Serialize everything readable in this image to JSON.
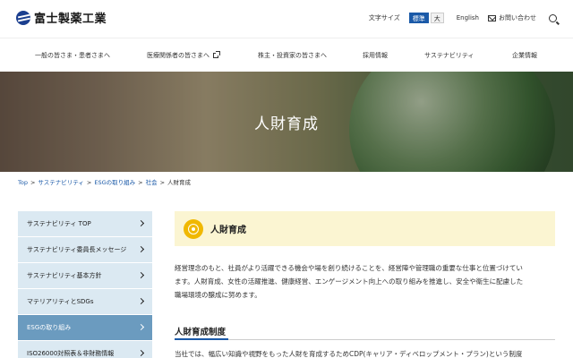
{
  "header": {
    "logo_text": "富士製薬工業",
    "font_size_label": "文字サイズ",
    "font_size_options": [
      "標準",
      "大"
    ],
    "english": "English",
    "contact": "お問い合わせ"
  },
  "nav": {
    "items": [
      "一般の皆さま・患者さまへ",
      "医療関係者の皆さまへ",
      "株主・投資家の皆さまへ",
      "採用情報",
      "サステナビリティ",
      "企業情報"
    ]
  },
  "hero": {
    "title": "人財育成"
  },
  "breadcrumb": [
    "Top",
    "サステナビリティ",
    "ESGの取り組み",
    "社会",
    "人財育成"
  ],
  "sidebar": {
    "items": [
      {
        "label": "サステナビリティ TOP"
      },
      {
        "label": "サステナビリティ委員長メッセージ"
      },
      {
        "label": "サステナビリティ基本方針"
      },
      {
        "label": "マテリアリティとSDGs"
      },
      {
        "label": "ESGの取り組み"
      },
      {
        "label": "ISO26000対照表＆非財務情報"
      }
    ]
  },
  "content": {
    "section_title": "人財育成",
    "body_lines": [
      "経営理念のもと、社員がより活躍できる機会や場を創り続けることを、経営陣や管理職の重要な仕事と位置づけてい",
      "ます。人財育成、女性の活躍推進、健康経営、エンゲージメント向上への取り組みを推進し、安全や衛生に配慮した",
      "職場環境の醸成に努めます。"
    ],
    "sub_heading": "人財育成制度",
    "cut_text": "当社では、幅広い知識や視野をもった人財を育成するためCDP(キャリア・ディベロップメント・プラン)という制度"
  }
}
